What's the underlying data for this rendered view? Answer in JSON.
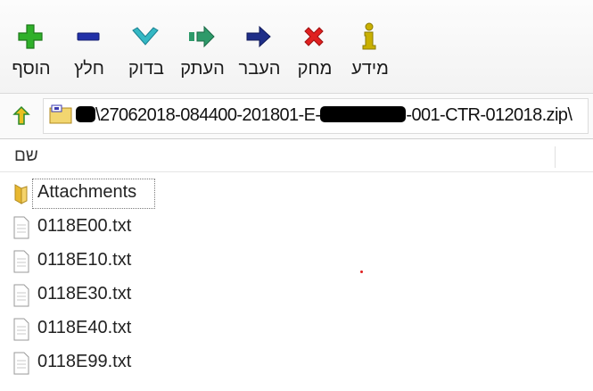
{
  "toolbar": {
    "buttons": [
      {
        "id": "add",
        "label": "הוסף",
        "icon": "plus-icon",
        "color": "#2fb02a"
      },
      {
        "id": "extract",
        "label": "חלץ",
        "icon": "minus-icon",
        "color": "#2230a8"
      },
      {
        "id": "test",
        "label": "בדוק",
        "icon": "check-icon",
        "color": "#34b8c4"
      },
      {
        "id": "copy",
        "label": "העתק",
        "icon": "copy-arrow-icon",
        "color": "#2e9a6a"
      },
      {
        "id": "move",
        "label": "העבר",
        "icon": "move-arrow-icon",
        "color": "#1e2e88"
      },
      {
        "id": "delete",
        "label": "מחק",
        "icon": "delete-x-icon",
        "color": "#e02020"
      },
      {
        "id": "info",
        "label": "מידע",
        "icon": "info-icon",
        "color": "#c9b000"
      }
    ]
  },
  "address": {
    "path_segment_1": "\\27062018-084400-201801-E-",
    "path_segment_2": "-001-CTR-012018.zip\\"
  },
  "list": {
    "column_name": "שם",
    "items": [
      {
        "name": "Attachments",
        "type": "folder"
      },
      {
        "name": "0118E00.txt",
        "type": "file"
      },
      {
        "name": "0118E10.txt",
        "type": "file"
      },
      {
        "name": "0118E30.txt",
        "type": "file"
      },
      {
        "name": "0118E40.txt",
        "type": "file"
      },
      {
        "name": "0118E99.txt",
        "type": "file"
      }
    ]
  }
}
